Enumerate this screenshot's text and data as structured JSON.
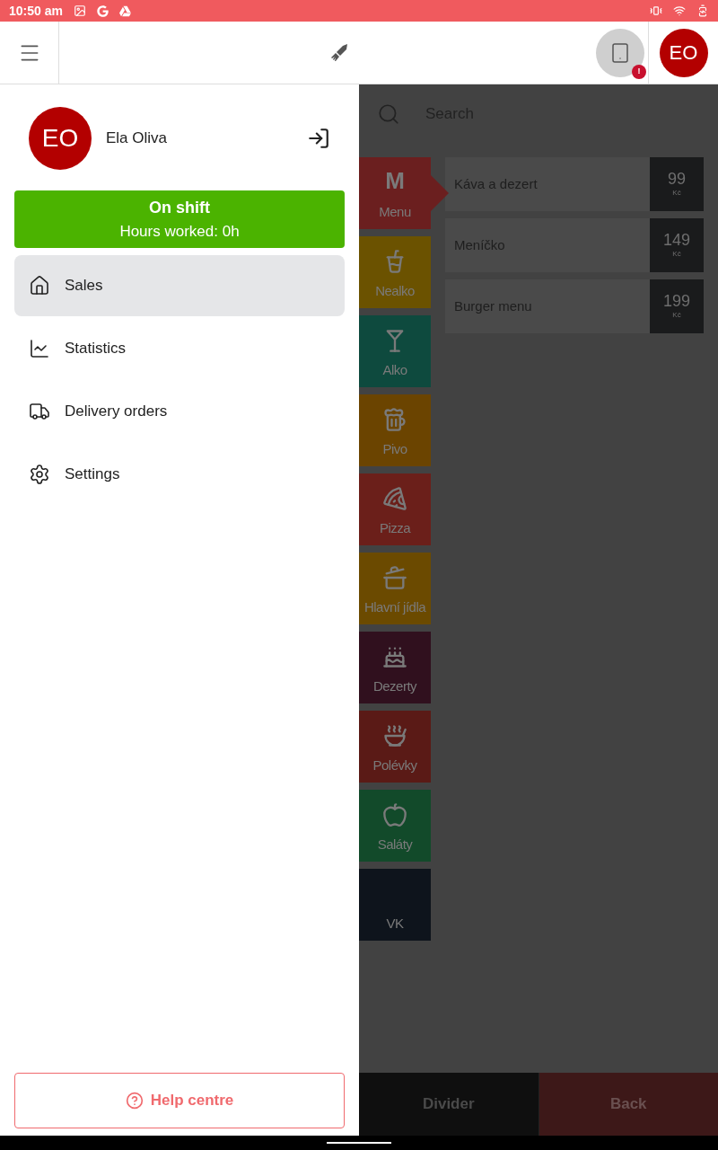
{
  "status_bar": {
    "time": "10:50 am"
  },
  "top_bar": {
    "avatar_initials": "EO",
    "device_alert": "!"
  },
  "drawer": {
    "user": {
      "initials": "EO",
      "name": "Ela Oliva"
    },
    "shift": {
      "title": "On shift",
      "hours": "Hours worked: 0h"
    },
    "items": [
      {
        "label": "Sales",
        "selected": true
      },
      {
        "label": "Statistics",
        "selected": false
      },
      {
        "label": "Delivery orders",
        "selected": false
      },
      {
        "label": "Settings",
        "selected": false
      }
    ],
    "help_button": "Help centre"
  },
  "search": {
    "placeholder": "Search"
  },
  "categories": [
    {
      "label": "Menu",
      "glyph": "M",
      "color": "#6b1f1f",
      "selected": true
    },
    {
      "label": "Nealko",
      "color": "#6b5200",
      "selected": false
    },
    {
      "label": "Alko",
      "color": "#0e4a3e",
      "selected": false
    },
    {
      "label": "Pivo",
      "color": "#6b4400",
      "selected": false
    },
    {
      "label": "Pizza",
      "color": "#6b1f1a",
      "selected": false
    },
    {
      "label": "Hlavní jídla",
      "color": "#6b4a00",
      "selected": false
    },
    {
      "label": "Dezerty",
      "color": "#30101e",
      "selected": false
    },
    {
      "label": "Polévky",
      "color": "#5a1a16",
      "selected": false
    },
    {
      "label": "Saláty",
      "color": "#124a2a",
      "selected": false
    },
    {
      "label": "VK",
      "color": "#0e141c",
      "selected": false
    }
  ],
  "products": [
    {
      "name": "Káva a dezert",
      "price": "99",
      "currency": "Kč"
    },
    {
      "name": "Meníčko",
      "price": "149",
      "currency": "Kč"
    },
    {
      "name": "Burger menu",
      "price": "199",
      "currency": "Kč"
    }
  ],
  "bottom_buttons": [
    {
      "label": "Divider",
      "kind": "neutral"
    },
    {
      "label": "Back",
      "kind": "danger"
    }
  ]
}
